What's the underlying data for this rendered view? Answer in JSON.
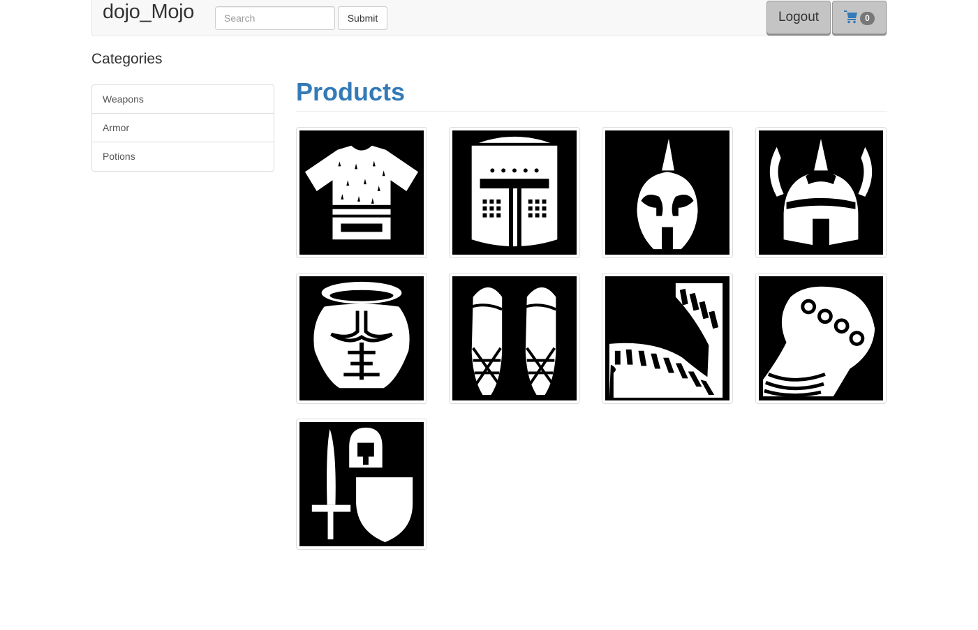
{
  "navbar": {
    "brand": "dojo_Mojo",
    "search_placeholder": "Search",
    "submit_label": "Submit",
    "logout_label": "Logout",
    "cart_icon": "shopping-cart-icon",
    "cart_count": "0"
  },
  "sidebar": {
    "heading": "Categories",
    "items": [
      {
        "label": "Weapons"
      },
      {
        "label": "Armor"
      },
      {
        "label": "Potions"
      }
    ]
  },
  "main": {
    "title": "Products",
    "products": [
      {
        "icon": "chainmail-shirt-icon"
      },
      {
        "icon": "great-helm-icon"
      },
      {
        "icon": "spartan-helmet-icon"
      },
      {
        "icon": "viking-helmet-icon"
      },
      {
        "icon": "breastplate-icon"
      },
      {
        "icon": "leg-armor-icon"
      },
      {
        "icon": "pauldron-icon"
      },
      {
        "icon": "gauntlet-icon"
      },
      {
        "icon": "sword-helmet-shield-icon"
      }
    ]
  },
  "colors": {
    "link_blue": "#337ab7",
    "navbar_bg": "#f8f8f8",
    "badge_gray": "#777777"
  }
}
